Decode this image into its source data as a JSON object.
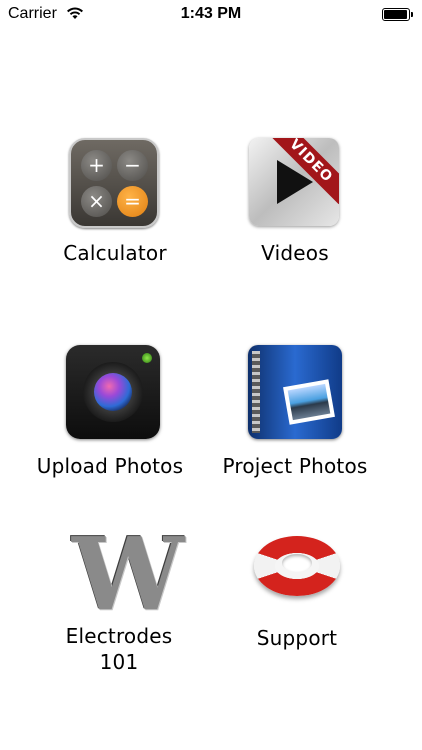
{
  "status_bar": {
    "carrier": "Carrier",
    "time": "1:43 PM"
  },
  "tiles": [
    {
      "label": "Calculator",
      "icon": "calculator-icon"
    },
    {
      "label": "Videos",
      "icon": "video-icon"
    },
    {
      "label": "Upload Photos",
      "icon": "camera-icon"
    },
    {
      "label": "Project Photos",
      "icon": "photo-album-icon"
    },
    {
      "label": "Electrodes\n101",
      "icon": "electrode-icon"
    },
    {
      "label": "Support",
      "icon": "life-buoy-icon"
    }
  ],
  "calculator_keys": [
    "+",
    "−",
    "×",
    "="
  ],
  "video_badge": "VIDEO",
  "electrode_glyph": "W",
  "colors": {
    "calc_equals": "#e07f12",
    "video_ribbon": "#a2161a",
    "buoy_red": "#d4231d",
    "camera_flash": "#2c7a12"
  }
}
